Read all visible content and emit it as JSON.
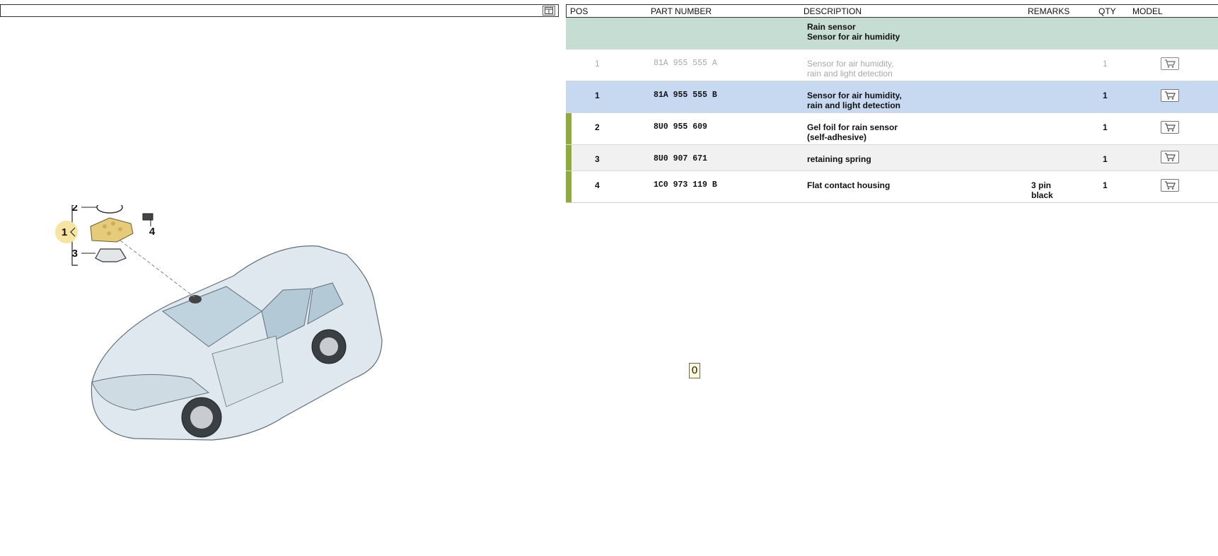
{
  "columns": {
    "pos": "POS",
    "part_number": "PART NUMBER",
    "description": "DESCRIPTION",
    "remarks": "REMARKS",
    "qty": "QTY",
    "model": "MODEL"
  },
  "group": {
    "line1": "Rain sensor",
    "line2": "Sensor for air humidity"
  },
  "rows": [
    {
      "pos": "1",
      "part": "81A 955 555 A",
      "desc1": "Sensor for air humidity,",
      "desc2": "rain and light detection",
      "remark1": "",
      "remark2": "",
      "qty": "1"
    },
    {
      "pos": "1",
      "part": "81A 955 555 B",
      "desc1": "Sensor for air humidity,",
      "desc2": "rain and light detection",
      "remark1": "",
      "remark2": "",
      "qty": "1"
    },
    {
      "pos": "2",
      "part": "8U0 955 609",
      "desc1": "Gel foil for rain sensor",
      "desc2": "(self-adhesive)",
      "remark1": "",
      "remark2": "",
      "qty": "1"
    },
    {
      "pos": "3",
      "part": "8U0 907 671",
      "desc1": "retaining spring",
      "desc2": "",
      "remark1": "",
      "remark2": "",
      "qty": "1"
    },
    {
      "pos": "4",
      "part": "1C0 973 119 B",
      "desc1": "Flat contact housing",
      "desc2": "",
      "remark1": "3 pin",
      "remark2": "black",
      "qty": "1"
    }
  ],
  "diagram": {
    "callouts": [
      "1",
      "2",
      "3",
      "4"
    ]
  },
  "page_indicator": "0",
  "colors": {
    "group_bg": "#c6ddd3",
    "selected_bg": "#c7d9f1",
    "marker": "#8fab3a",
    "highlight": "#f7e4a0"
  },
  "icons": {
    "toolbar": "layout-toggle-icon",
    "cart": "shopping-cart-icon"
  }
}
